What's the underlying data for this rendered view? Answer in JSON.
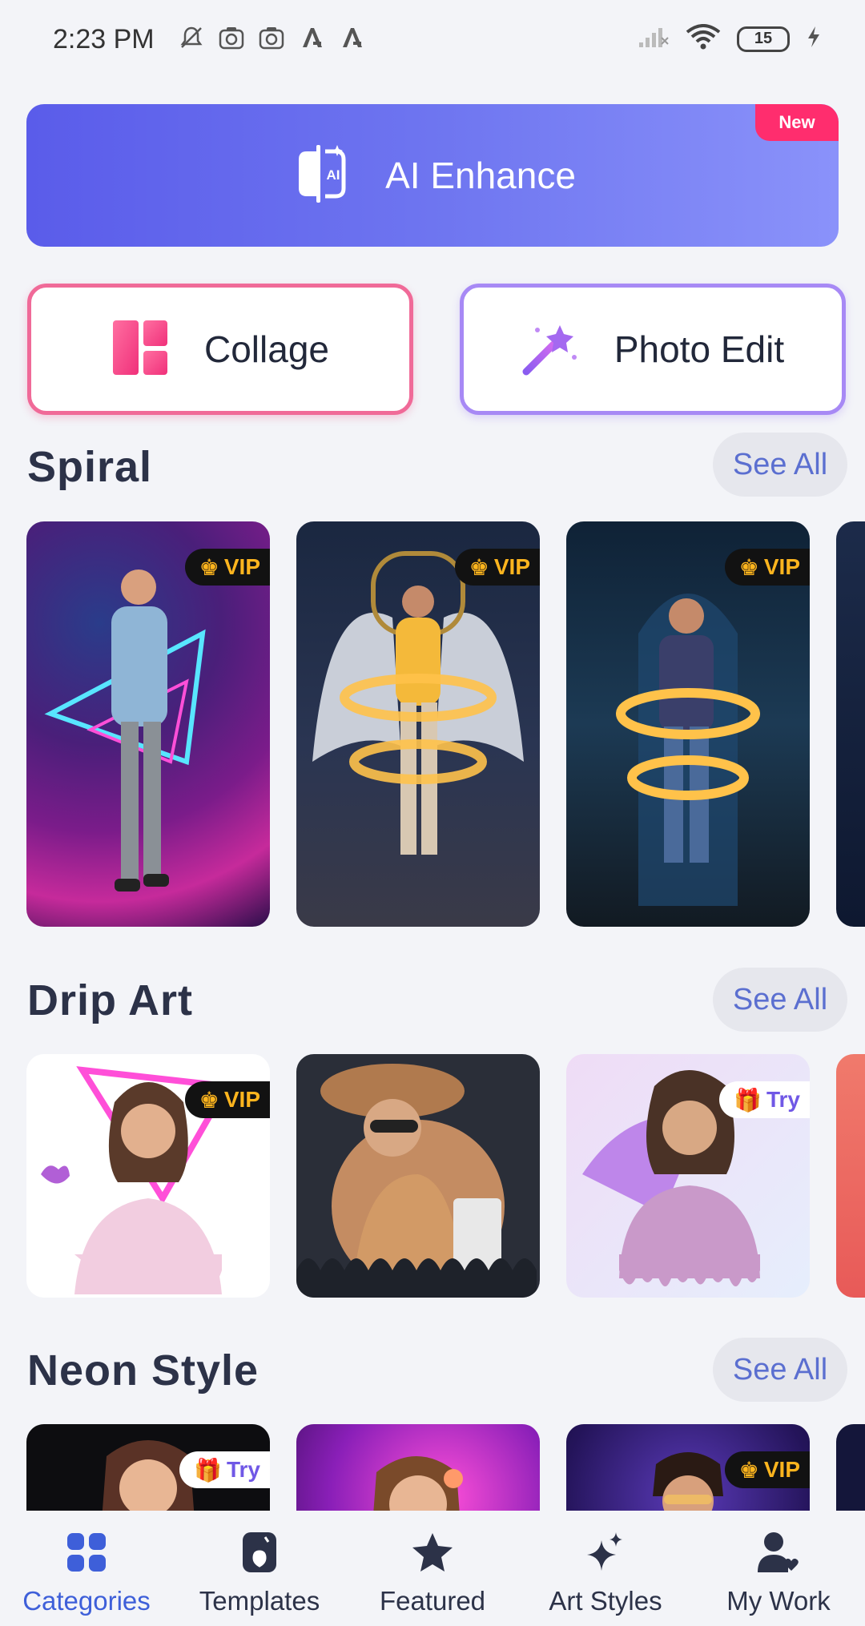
{
  "status_bar": {
    "time": "2:23 PM",
    "battery": "15",
    "icons_left": [
      "mute-icon",
      "camera-icon",
      "camera-icon",
      "a-icon",
      "a-icon"
    ],
    "icons_right": [
      "signal-icon",
      "wifi-icon",
      "battery-icon",
      "charging-icon"
    ]
  },
  "ai_banner": {
    "label": "AI Enhance",
    "badge": "New",
    "icon_text": "AI",
    "colors": {
      "start": "#5a5cea",
      "end": "#8a92fa",
      "badge": "#ff2d6e"
    }
  },
  "tools": {
    "collage_label": "Collage",
    "photo_edit_label": "Photo Edit"
  },
  "sections": [
    {
      "title": "Spiral",
      "see_all": "See All",
      "cards": [
        {
          "badge": "VIP",
          "badge_type": "vip"
        },
        {
          "badge": "VIP",
          "badge_type": "vip"
        },
        {
          "badge": "VIP",
          "badge_type": "vip"
        }
      ]
    },
    {
      "title": "Drip Art",
      "see_all": "See All",
      "cards": [
        {
          "badge": "VIP",
          "badge_type": "vip"
        },
        {
          "badge": "",
          "badge_type": "none"
        },
        {
          "badge": "Try",
          "badge_type": "try"
        }
      ]
    },
    {
      "title": "Neon Style",
      "see_all": "See All",
      "cards": [
        {
          "badge": "Try",
          "badge_type": "try"
        },
        {
          "badge": "",
          "badge_type": "none"
        },
        {
          "badge": "VIP",
          "badge_type": "vip"
        }
      ]
    }
  ],
  "bottom_nav": [
    {
      "label": "Categories",
      "icon": "grid-icon",
      "active": true
    },
    {
      "label": "Templates",
      "icon": "template-icon",
      "active": false
    },
    {
      "label": "Featured",
      "icon": "star-icon",
      "active": false
    },
    {
      "label": "Art Styles",
      "icon": "sparkle-icon",
      "active": false
    },
    {
      "label": "My Work",
      "icon": "user-heart-icon",
      "active": false
    }
  ],
  "colors": {
    "active_nav": "#3e5fd9",
    "vip_text": "#ffb51e",
    "try_text": "#7058e6"
  }
}
